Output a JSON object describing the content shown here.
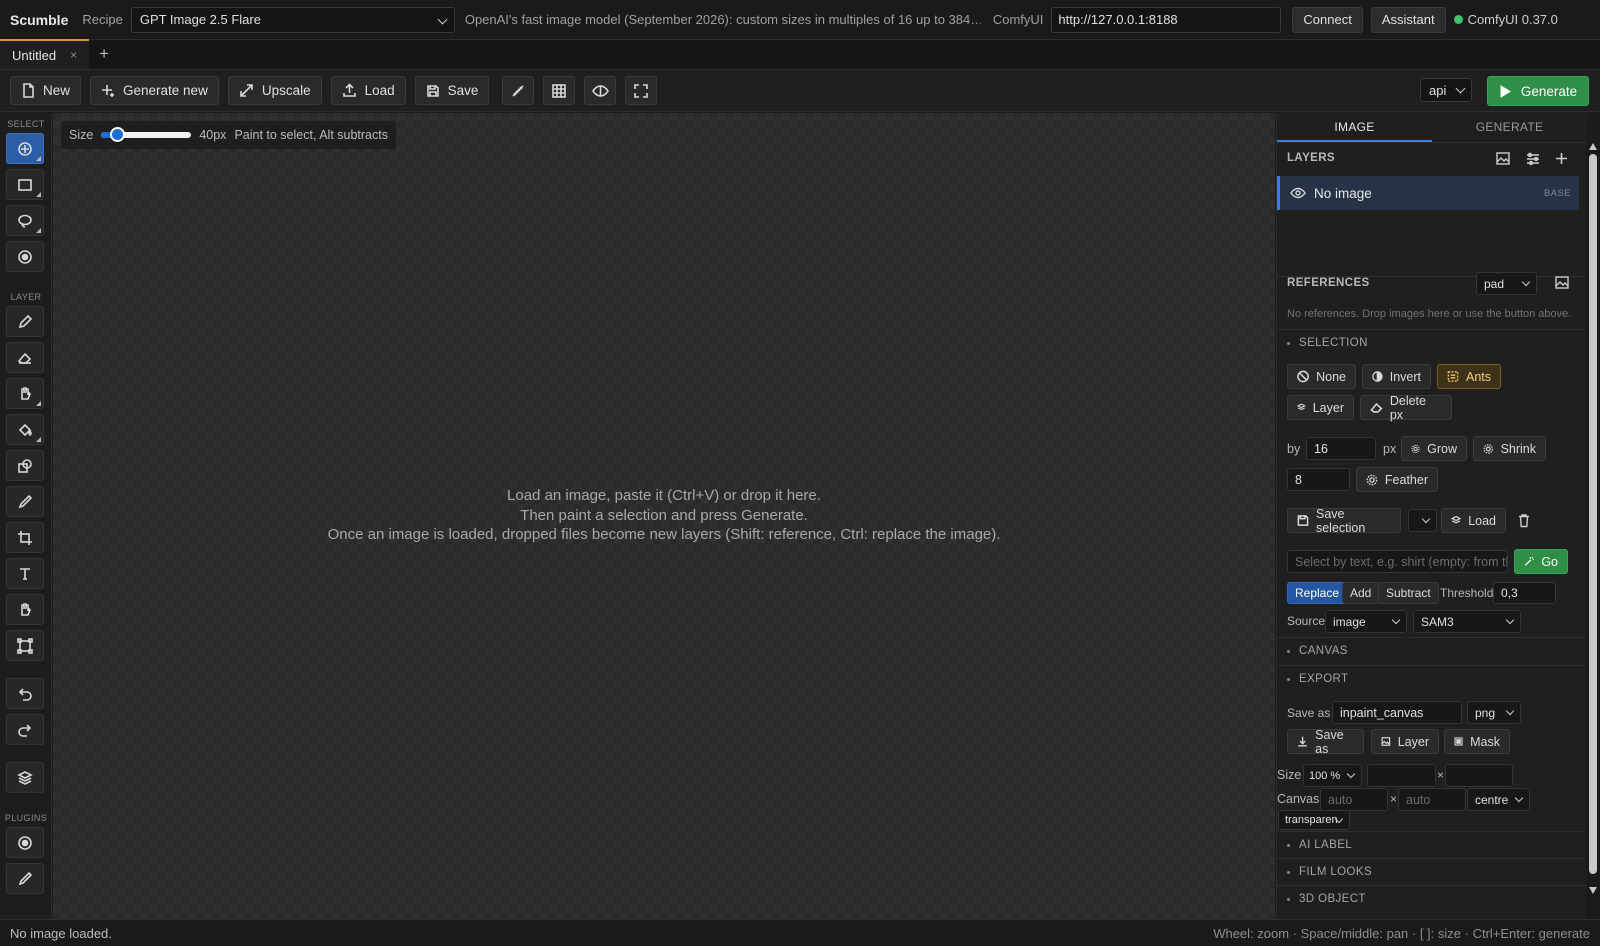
{
  "topbar": {
    "brand": "Scumble",
    "recipe_label": "Recipe",
    "recipe_value": "GPT Image 2.5 Flare",
    "recipe_desc": "OpenAI's fast image model (September 2026): custom sizes in multiples of 16 up to 384…",
    "comfy_label": "ComfyUI",
    "comfy_url": "http://127.0.0.1:8188",
    "connect": "Connect",
    "assistant": "Assistant",
    "status": "ComfyUI 0.37.0",
    "status_color": "#3ec46d"
  },
  "tabs": {
    "doc": "Untitled",
    "close": "×",
    "add": "+"
  },
  "toolbar": {
    "new": "New",
    "generate_new": "Generate new",
    "upscale": "Upscale",
    "load": "Load",
    "save": "Save",
    "api": "api",
    "generate": "Generate",
    "accent": "#2f8f46"
  },
  "lefttools": {
    "select": "SELECT",
    "layer": "LAYER",
    "plugins": "PLUGINS"
  },
  "canvas": {
    "size_label": "Size",
    "size_value": "40px",
    "size_pct": 0.12,
    "size_hint": "Paint to select, Alt subtracts",
    "hint1": "Load an image, paste it (Ctrl+V) or drop it here.",
    "hint2": "Then paint a selection and press Generate.",
    "hint3": "Once an image is loaded, dropped files become new layers (Shift: reference, Ctrl: replace the image)."
  },
  "panel": {
    "tab_image": "IMAGE",
    "tab_generate": "GENERATE",
    "layers_title": "LAYERS",
    "layer_name": "No image",
    "layer_badge": "BASE",
    "refs_title": "REFERENCES",
    "refs_mode": "pad",
    "refs_empty": "No references. Drop images here or use the button above.",
    "selection_title": "SELECTION",
    "btn_none": "None",
    "btn_invert": "Invert",
    "btn_ants": "Ants",
    "btn_layer": "Layer",
    "btn_delete": "Delete px",
    "by_label": "by",
    "by_value": "16",
    "px": "px",
    "btn_grow": "Grow",
    "btn_shrink": "Shrink",
    "feather_value": "8",
    "btn_feather": "Feather",
    "btn_save_sel": "Save selection",
    "btn_load": "Load",
    "text_placeholder": "Select by text, e.g. shirt (empty: from the prompt)",
    "btn_go": "Go",
    "mode_replace": "Replace",
    "mode_add": "Add",
    "mode_subtract": "Subtract",
    "threshold_label": "Threshold",
    "threshold_value": "0,3",
    "source_label": "Source",
    "source_value": "image",
    "model_value": "SAM3",
    "canvas_title": "CANVAS",
    "export_title": "EXPORT",
    "saveas_label": "Save as",
    "saveas_value": "inpaint_canvas",
    "format_value": "png",
    "btn_saveas": "Save as",
    "btn_exlayer": "Layer",
    "btn_mask": "Mask",
    "size_label": "Size",
    "size_value": "100 %",
    "x": "×",
    "canvas_label": "Canvas",
    "canvas_w": "auto",
    "canvas_h": "auto",
    "anchor_value": "centre",
    "bg_value": "transparen",
    "ai_label_title": "AI LABEL",
    "film_title": "FILM LOOKS",
    "obj_title": "3D OBJECT"
  },
  "statusbar": {
    "left": "No image loaded.",
    "right": "Wheel: zoom · Space/middle: pan · [ ]: size · Ctrl+Enter: generate"
  }
}
